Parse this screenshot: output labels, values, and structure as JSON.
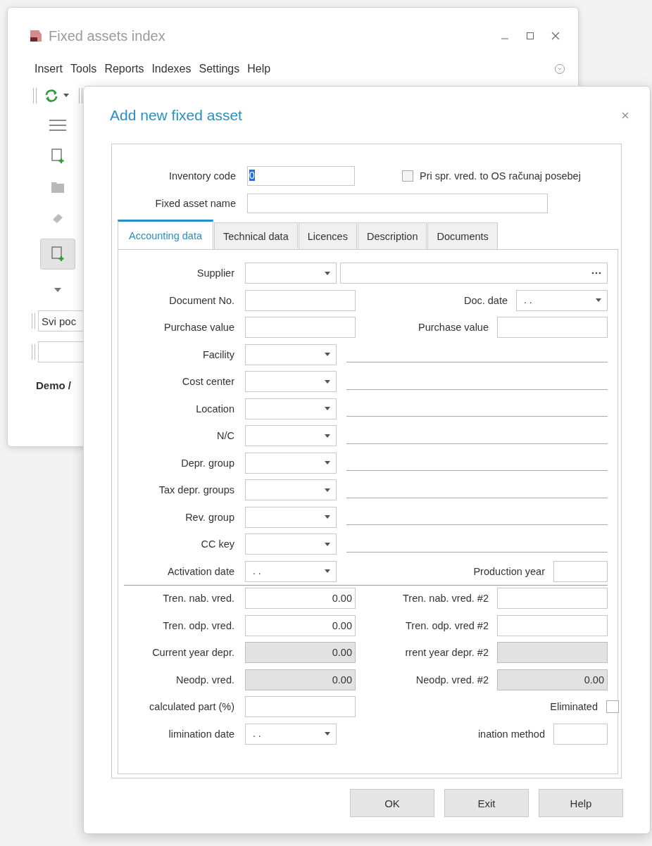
{
  "back_window": {
    "title": "Fixed assets index",
    "menu": [
      "Insert",
      "Tools",
      "Reports",
      "Indexes",
      "Settings",
      "Help"
    ],
    "tools": [
      {
        "kind": "menu",
        "selected": false
      },
      {
        "kind": "new",
        "selected": false
      },
      {
        "kind": "folder",
        "selected": false
      },
      {
        "kind": "eraser",
        "selected": false
      },
      {
        "kind": "new",
        "selected": true
      },
      {
        "kind": "caret",
        "selected": false
      }
    ],
    "filter_field": {
      "value": "Svi poc"
    },
    "status": "Demo /"
  },
  "dialog": {
    "title": "Add new fixed asset",
    "inventory_code": {
      "label": "Inventory code",
      "value": "0",
      "value_selected": true
    },
    "separate_checkbox": {
      "label": "Pri spr. vred. to OS računaj posebej",
      "checked": false
    },
    "name_field": {
      "label": "Fixed asset name"
    },
    "tabs": [
      {
        "label": "Accounting data",
        "selected": true
      },
      {
        "label": "Technical data",
        "selected": false
      },
      {
        "label": "Licences",
        "selected": false
      },
      {
        "label": "Description",
        "selected": false
      },
      {
        "label": "Documents",
        "selected": false
      }
    ],
    "rows": [
      {
        "label": "Supplier",
        "kind": "lookup",
        "right": {
          "kind": "none"
        }
      },
      {
        "label": "Document No.",
        "kind": "text",
        "disabled": false,
        "right": {
          "label": "Doc. date",
          "kind": "date",
          "value": ". ."
        }
      },
      {
        "label": "Purchase value",
        "kind": "text",
        "disabled": false,
        "right": {
          "label": "Purchase value",
          "kind": "text",
          "disabled": false
        }
      },
      {
        "label": "Facility",
        "kind": "combo_line",
        "right": {
          "kind": "none"
        }
      },
      {
        "label": "Cost center",
        "kind": "combo_line",
        "right": {
          "kind": "none"
        }
      },
      {
        "label": "Location",
        "kind": "combo_line",
        "right": {
          "kind": "none"
        }
      },
      {
        "label": "N/C",
        "kind": "combo_line",
        "right": {
          "kind": "none"
        }
      },
      {
        "label": "Depr. group",
        "kind": "combo_line",
        "right": {
          "kind": "none"
        }
      },
      {
        "label": "Tax depr. groups",
        "kind": "combo_line",
        "right": {
          "kind": "none"
        }
      },
      {
        "label": "Rev. group",
        "kind": "combo_line",
        "right": {
          "kind": "none"
        }
      },
      {
        "label": "CC key",
        "kind": "combo_line",
        "right": {
          "kind": "none"
        }
      },
      {
        "label": "Activation date",
        "kind": "date",
        "value": ". .",
        "separator_after": true,
        "right": {
          "label": "Production year",
          "kind": "short",
          "disabled": false
        }
      },
      {
        "label": "Tren. nab. vred.",
        "kind": "text",
        "value": "0.00",
        "disabled": false,
        "right": {
          "label": "Tren. nab. vred. #2",
          "kind": "text",
          "disabled": false
        }
      },
      {
        "label": "Tren. odp. vred.",
        "kind": "text",
        "value": "0.00",
        "disabled": false,
        "right": {
          "label": "Tren. odp. vred #2",
          "kind": "text",
          "disabled": false
        }
      },
      {
        "label": "Current year depr.",
        "kind": "text",
        "value": "0.00",
        "disabled": true,
        "right": {
          "label": "rrent year depr. #2",
          "kind": "text",
          "disabled": true
        }
      },
      {
        "label": "Neodp. vred.",
        "kind": "text",
        "value": "0.00",
        "disabled": true,
        "right": {
          "label": "Neodp. vred. #2",
          "kind": "text",
          "value": "0.00",
          "disabled": true
        }
      },
      {
        "label": "calculated part (%)",
        "kind": "text",
        "disabled": false,
        "right": {
          "label": "Eliminated",
          "kind": "checkbox",
          "checked": false
        }
      },
      {
        "label": "limination date",
        "kind": "date",
        "value": ". .",
        "right": {
          "label": "ination method",
          "kind": "short",
          "disabled": false
        }
      }
    ],
    "buttons": [
      "OK",
      "Exit",
      "Help"
    ]
  }
}
